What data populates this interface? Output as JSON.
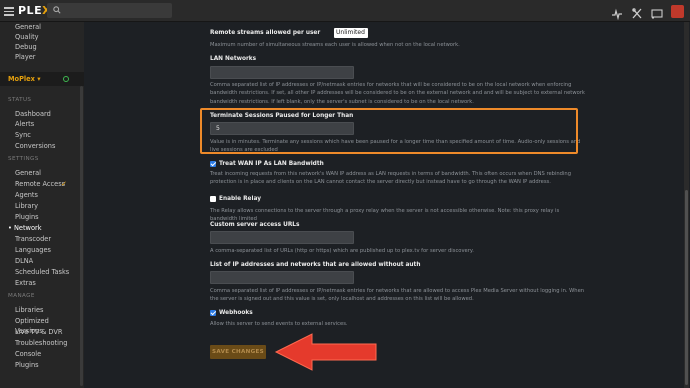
{
  "topbar": {
    "logo_main": "PLE",
    "logo_x": "X",
    "icons": [
      "activity-icon",
      "settings-icon",
      "cast-icon",
      "user-avatar"
    ]
  },
  "sidebar": {
    "top_items": [
      "General",
      "Quality",
      "Debug",
      "Player"
    ],
    "server_name": "MoPlex ▾",
    "status_header": "STATUS",
    "status_items": [
      "Dashboard",
      "Alerts",
      "Sync",
      "Conversions"
    ],
    "settings_header": "SETTINGS",
    "settings_items": [
      "General",
      "Remote Access",
      "Agents",
      "Library",
      "Plugins",
      "Network",
      "Transcoder",
      "Languages",
      "DLNA",
      "Scheduled Tasks",
      "Extras"
    ],
    "active_item": "• Network",
    "manage_header": "MANAGE",
    "manage_items": [
      "Libraries",
      "Optimized Versions",
      "Live TV & DVR",
      "Troubleshooting",
      "Console",
      "Plugins"
    ]
  },
  "settings": {
    "remote_streams_label": "Remote streams allowed per user",
    "remote_streams_value": "Unlimited ▾",
    "remote_streams_desc": "Maximum number of simultaneous streams each user is allowed when not on the local network.",
    "lan_label": "LAN Networks",
    "lan_value": "",
    "lan_desc": "Comma separated list of IP addresses or IP/netmask entries for networks that will be considered to be on the local network when enforcing bandwidth restrictions. If set, all other IP addresses will be considered to be on the external network and and will be subject to external network bandwidth restrictions. If left blank, only the server's subnet is considered to be on the local network.",
    "terminate_label": "Terminate Sessions Paused for Longer Than",
    "terminate_value": "5",
    "terminate_desc": "Value is in minutes. Terminate any sessions which have been paused for a longer time than specified amount of time. Audio-only sessions and live sessions are excluded",
    "wan_label": "Treat WAN IP As LAN Bandwidth",
    "wan_desc": "Treat incoming requests from this network's WAN IP address as LAN requests in terms of bandwidth. This often occurs when DNS rebinding protection is in place and clients on the LAN cannot contact the server directly but instead have to go through the WAN IP address.",
    "relay_label": "Enable Relay",
    "relay_desc": "The Relay allows connections to the server through a proxy relay when the server is not accessible otherwise. Note: this proxy relay is bandwidth limited",
    "custom_urls_label": "Custom server access URLs",
    "custom_urls_value": "",
    "custom_urls_desc": "A comma-separated list of URLs (http or https) which are published up to plex.tv for server discovery.",
    "noauth_label": "List of IP addresses and networks that are allowed without auth",
    "noauth_value": "",
    "noauth_desc": "Comma separated list of IP addresses or IP/netmask entries for networks that are allowed to access Plex Media Server without logging in. When the server is signed out and this value is set, only localhost and addresses on this list will be allowed.",
    "webhooks_label": "Webhooks",
    "webhooks_desc": "Allow this server to send events to external services.",
    "save_label": "SAVE CHANGES"
  },
  "colors": {
    "accent": "#e5a00d",
    "highlight": "#ee8a2a",
    "arrow": "#e53a2c"
  }
}
